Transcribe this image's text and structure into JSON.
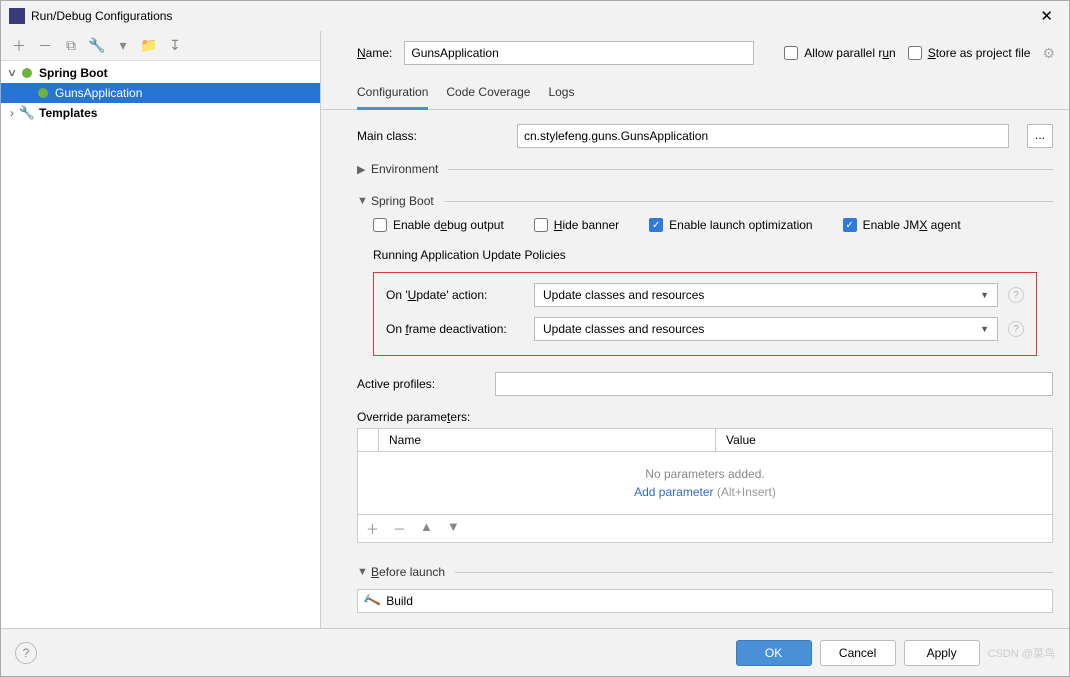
{
  "window": {
    "title": "Run/Debug Configurations"
  },
  "tree": {
    "root1": "Spring Boot",
    "child1": "GunsApplication",
    "root2": "Templates"
  },
  "header": {
    "name_label": "Name:",
    "name_value": "GunsApplication",
    "allow_parallel": "Allow parallel run",
    "store_project": "Store as project file"
  },
  "tabs": {
    "t1": "Configuration",
    "t2": "Code Coverage",
    "t3": "Logs"
  },
  "form": {
    "main_class_label": "Main class:",
    "main_class_value": "cn.stylefeng.guns.GunsApplication",
    "environment": "Environment",
    "spring_boot": "Spring Boot",
    "enable_debug": "Enable debug output",
    "hide_banner": "Hide banner",
    "enable_launch_opt": "Enable launch optimization",
    "enable_jmx": "Enable JMX agent",
    "policies_title": "Running Application Update Policies",
    "on_update_label": "On 'Update' action:",
    "on_update_value": "Update classes and resources",
    "on_frame_label": "On frame deactivation:",
    "on_frame_value": "Update classes and resources",
    "active_profiles_label": "Active profiles:",
    "override_label": "Override parameters:",
    "col_name": "Name",
    "col_value": "Value",
    "no_params": "No parameters added.",
    "add_param": "Add parameter",
    "add_param_shortcut": "(Alt+Insert)",
    "before_launch": "Before launch",
    "build": "Build"
  },
  "footer": {
    "ok": "OK",
    "cancel": "Cancel",
    "apply": "Apply",
    "watermark": "CSDN @菜鸟"
  }
}
